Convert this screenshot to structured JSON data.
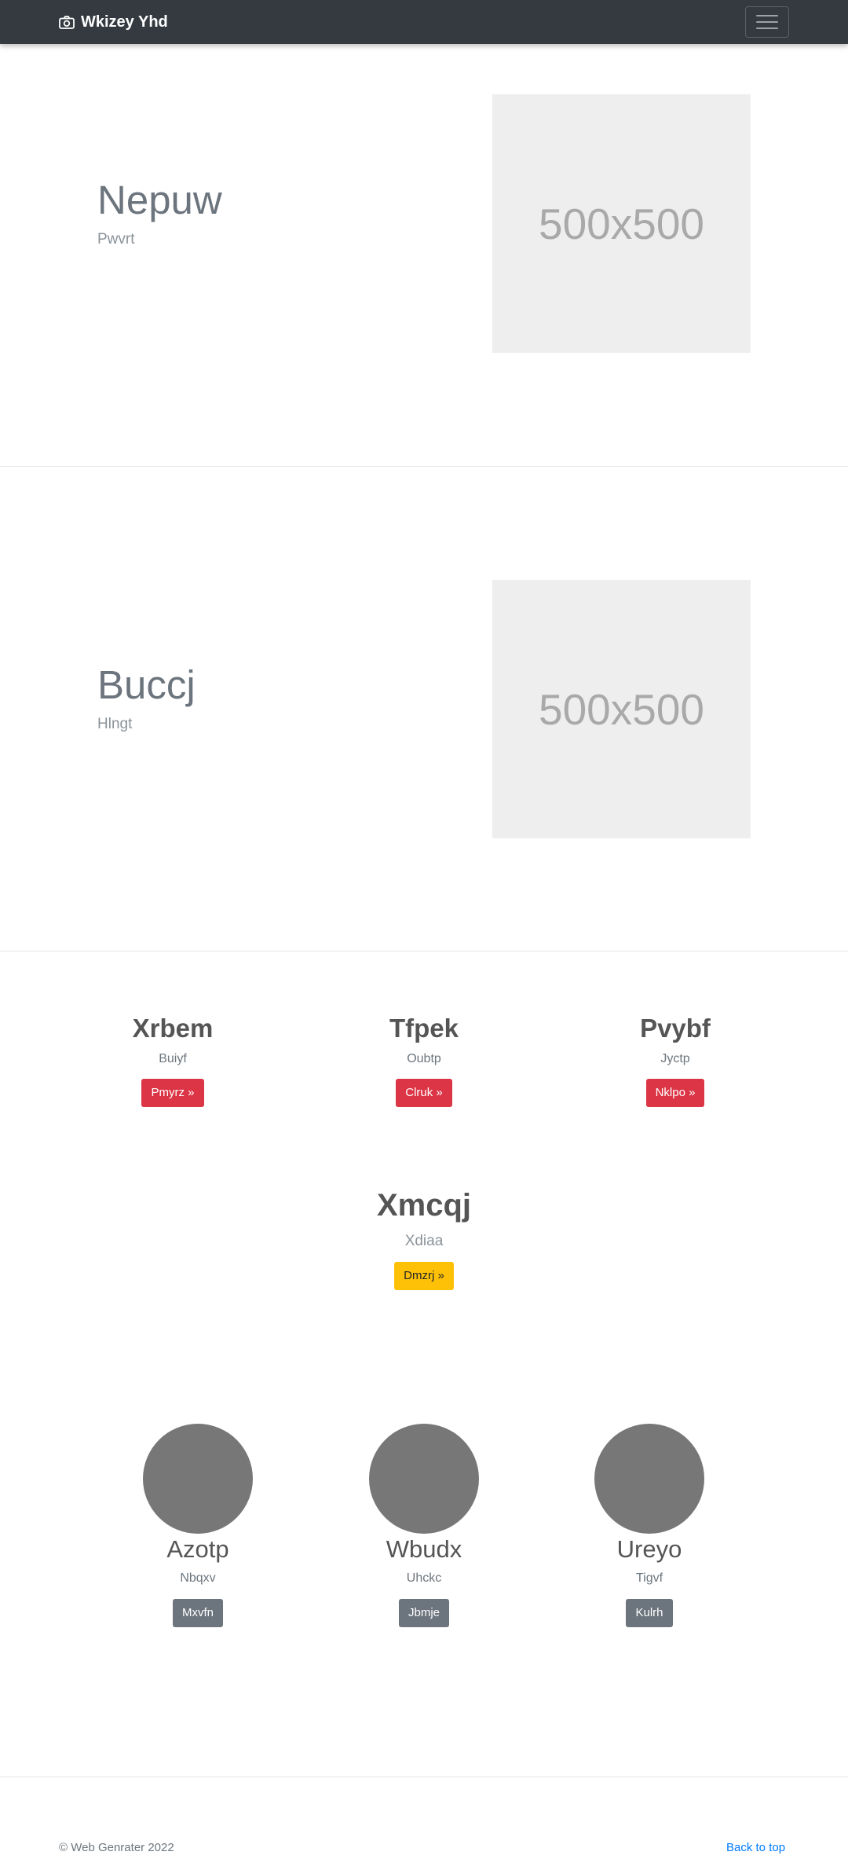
{
  "navbar": {
    "brand": "Wkizey Yhd",
    "brand_icon": "camera-icon",
    "toggler_icon": "hamburger-icon"
  },
  "heroes": [
    {
      "title": "Nepuw",
      "subtitle": "Pwvrt",
      "image_text": "500x500"
    },
    {
      "title": "Buccj",
      "subtitle": "Hlngt",
      "image_text": "500x500"
    }
  ],
  "features": [
    {
      "title": "Xrbem",
      "subtitle": "Buiyf",
      "button": "Pmyrz »"
    },
    {
      "title": "Tfpek",
      "subtitle": "Oubtp",
      "button": "Clruk »"
    },
    {
      "title": "Pvybf",
      "subtitle": "Jyctp",
      "button": "Nklpo »"
    }
  ],
  "center": {
    "title": "Xmcqj",
    "subtitle": "Xdiaa",
    "button": "Dmzrj »"
  },
  "people": [
    {
      "name": "Azotp",
      "subtitle": "Nbqxv",
      "button": "Mxvfn"
    },
    {
      "name": "Wbudx",
      "subtitle": "Uhckc",
      "button": "Jbmje"
    },
    {
      "name": "Ureyo",
      "subtitle": "Tigvf",
      "button": "Kulrh"
    }
  ],
  "footer": {
    "copyright": "© Web Genrater 2022",
    "back_to_top": "Back to top"
  },
  "colors": {
    "navbar": "#343a40",
    "danger": "#dc3545",
    "warning": "#ffc107",
    "secondary": "#6c757d",
    "link": "#007bff"
  }
}
